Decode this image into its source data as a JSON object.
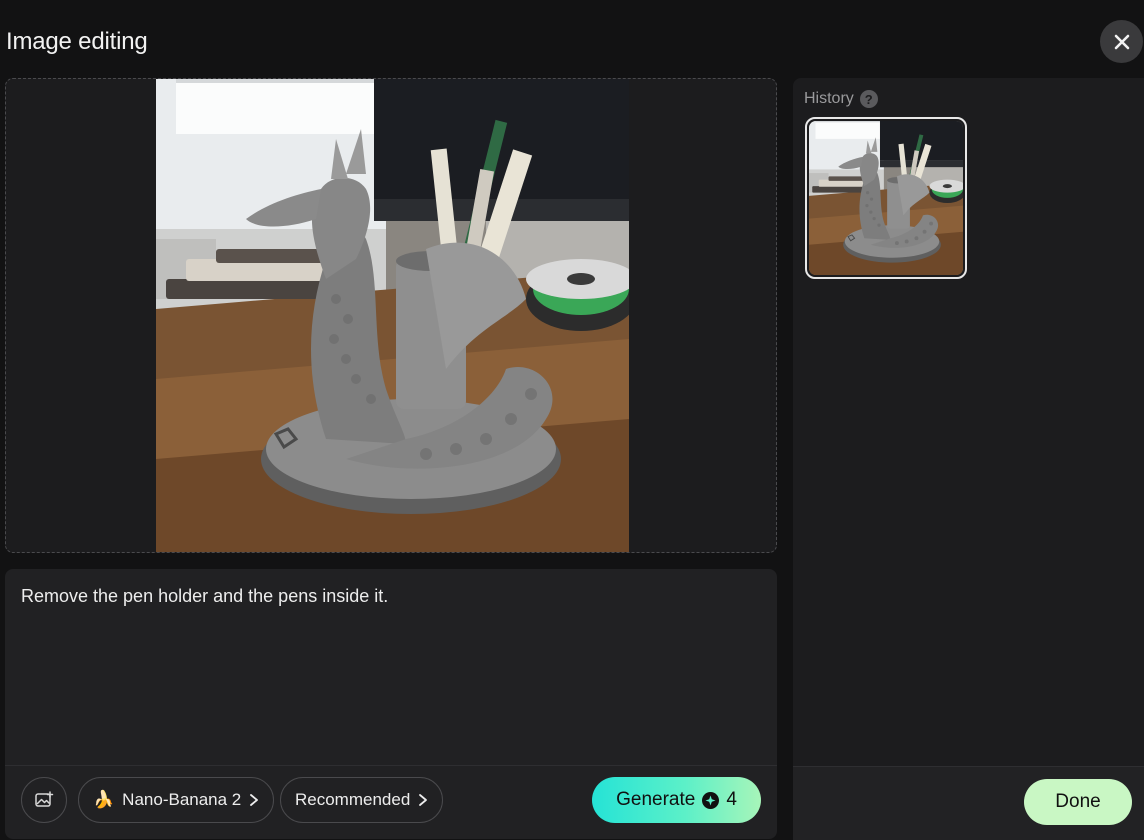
{
  "header": {
    "title": "Image editing",
    "close_icon": "close-icon"
  },
  "prompt": {
    "text": "Remove the pen holder and the pens inside it."
  },
  "toolbar": {
    "image_icon": "add-image-icon",
    "model_emoji": "🍌",
    "model_label": "Nano-Banana 2",
    "preset_label": "Recommended",
    "generate_label": "Generate",
    "generate_cost": "4"
  },
  "history": {
    "label": "History",
    "help_symbol": "?"
  },
  "footer": {
    "done_label": "Done"
  },
  "colors": {
    "background": "#121213",
    "panel": "#212123",
    "generate_gradient_start": "#25e3d6",
    "generate_gradient_end": "#a7f5b9",
    "done_bg": "#c9f7c4"
  }
}
